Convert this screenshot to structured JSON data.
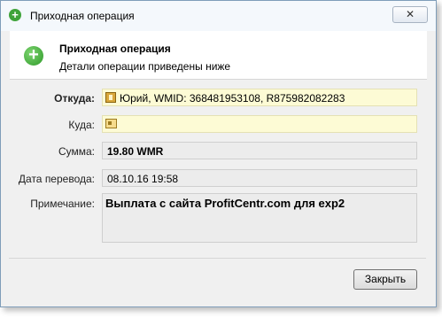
{
  "window": {
    "title": "Приходная операция",
    "close_glyph": "✕"
  },
  "header": {
    "title": "Приходная операция",
    "subtitle": "Детали операции приведены ниже",
    "icon": "plus-circle-icon"
  },
  "form": {
    "from_label": "Откуда:",
    "from_value": "Юрий, WMID: 368481953108, R875982082283",
    "from_icon": "wm-passport-icon",
    "to_label": "Куда:",
    "to_value": "",
    "to_icon": "wm-card-icon",
    "amount_label": "Сумма:",
    "amount_value": "19.80 WMR",
    "date_label": "Дата перевода:",
    "date_value": "08.10.16 19:58",
    "note_label": "Примечание:",
    "note_value": "Выплата с сайта ProfitCentr.com для exp2"
  },
  "footer": {
    "close_label": "Закрыть"
  },
  "colors": {
    "accent_green": "#3fa33a",
    "field_yellow": "#fdfbd5",
    "field_gray": "#ececec"
  }
}
